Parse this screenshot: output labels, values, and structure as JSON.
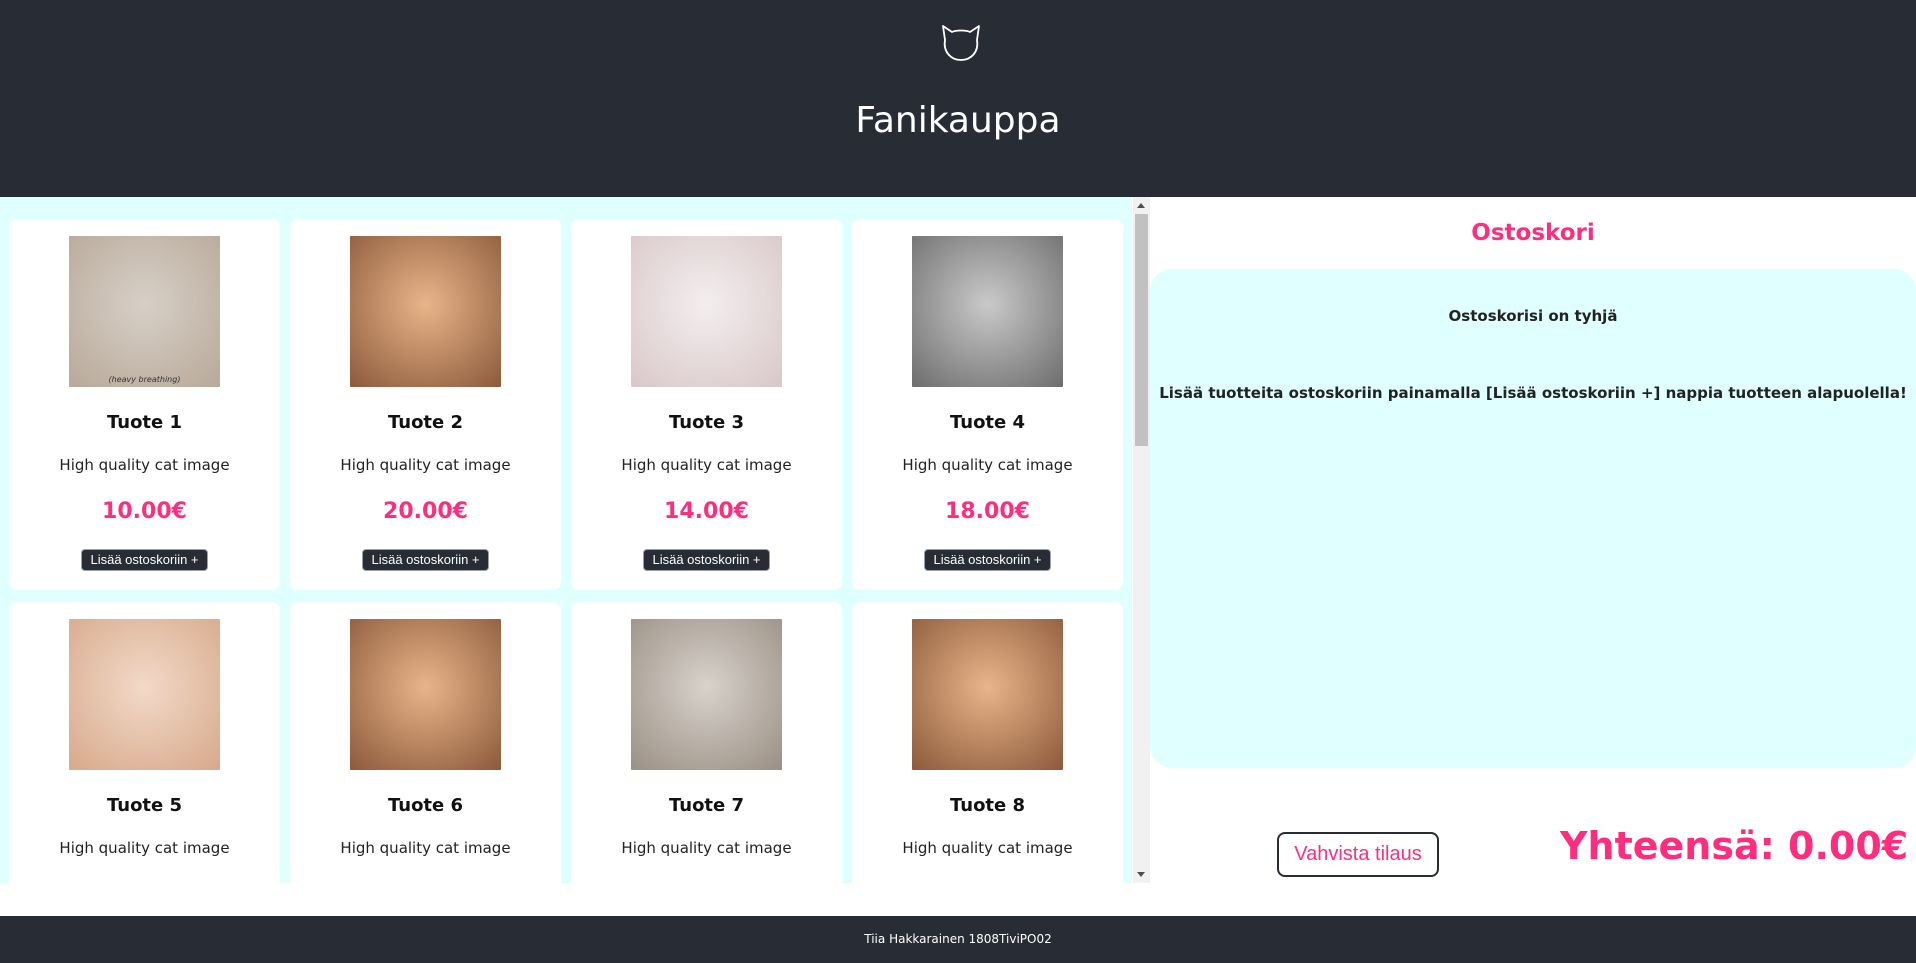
{
  "header": {
    "logo_icon": "cat-head-outline-icon",
    "title": "Fanikauppa"
  },
  "products": [
    {
      "name": "Tuote 1",
      "description": "High quality cat image",
      "price": "10.00€",
      "add_label": "Lisää ostoskoriin +",
      "image_caption": "(heavy breathing)",
      "image_colors": [
        "#d7cfc7",
        "#b8a999"
      ]
    },
    {
      "name": "Tuote 2",
      "description": "High quality cat image",
      "price": "20.00€",
      "add_label": "Lisää ostoskoriin +",
      "image_colors": [
        "#e8b48a",
        "#8c5a3a"
      ]
    },
    {
      "name": "Tuote 3",
      "description": "High quality cat image",
      "price": "14.00€",
      "add_label": "Lisää ostoskoriin +",
      "image_colors": [
        "#f3eeee",
        "#d9c7c9"
      ]
    },
    {
      "name": "Tuote 4",
      "description": "High quality cat image",
      "price": "18.00€",
      "add_label": "Lisää ostoskoriin +",
      "image_colors": [
        "#c9c9c9",
        "#6d6d6d"
      ]
    },
    {
      "name": "Tuote 5",
      "description": "High quality cat image",
      "price": "",
      "add_label": "",
      "image_colors": [
        "#f2d9c8",
        "#d7a98a"
      ]
    },
    {
      "name": "Tuote 6",
      "description": "High quality cat image",
      "price": "",
      "add_label": "",
      "image_colors": [
        "#e8b48a",
        "#8c5a3a"
      ]
    },
    {
      "name": "Tuote 7",
      "description": "High quality cat image",
      "price": "",
      "add_label": "",
      "image_colors": [
        "#d8d2cb",
        "#9a8f84"
      ]
    },
    {
      "name": "Tuote 8",
      "description": "High quality cat image",
      "price": "",
      "add_label": "",
      "image_colors": [
        "#e8b48a",
        "#8c5a3a"
      ]
    }
  ],
  "cart": {
    "title": "Ostoskori",
    "empty_message": "Ostoskorisi on tyhjä",
    "hint": "Lisää tuotteita ostoskoriin painamalla [Lisää ostoskoriin +] nappia tuotteen alapuolella!",
    "confirm_label": "Vahvista tilaus",
    "total": "Yhteensä: 0.00€"
  },
  "footer": {
    "text": "Tiia Hakkarainen 1808TiviPO02"
  },
  "colors": {
    "header_bg": "#282c34",
    "accent_pink": "#ff2d7d",
    "panel_bg": "#e0ffff"
  }
}
